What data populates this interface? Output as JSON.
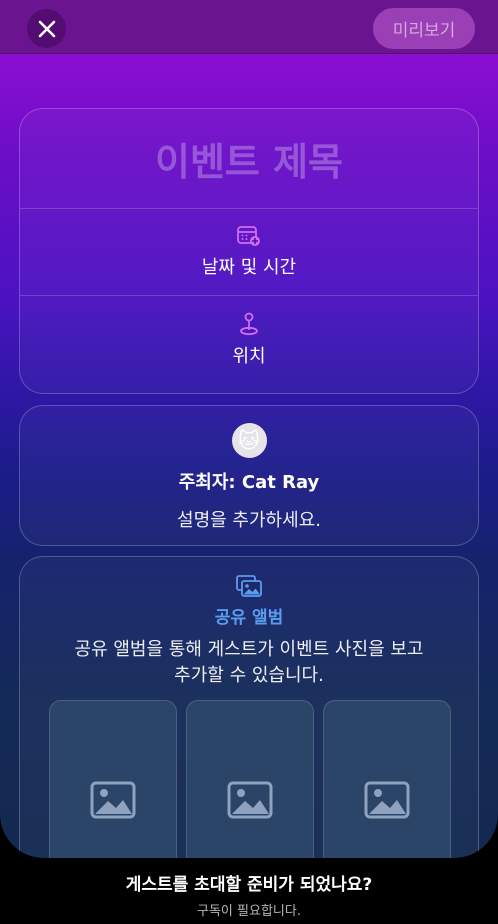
{
  "header": {
    "close_icon": "close-icon",
    "preview_label": "미리보기"
  },
  "event": {
    "title_placeholder": "이벤트 제목",
    "date_time_label": "날짜 및 시간",
    "date_icon": "calendar-add-icon",
    "location_label": "위치",
    "location_icon": "location-pin-icon"
  },
  "host": {
    "avatar_emoji": "🐱",
    "name_label": "주최자: Cat Ray",
    "description_placeholder": "설명을 추가하세요."
  },
  "album": {
    "icon": "photo-album-icon",
    "title": "공유 앨범",
    "description_line1": "공유 앨범을 통해 게스트가 이벤트 사진을 보고",
    "description_line2": "추가할 수 있습니다.",
    "tiles": [
      {
        "icon": "image-placeholder-icon"
      },
      {
        "icon": "image-placeholder-icon"
      },
      {
        "icon": "image-placeholder-icon"
      }
    ]
  },
  "footer": {
    "question": "게스트를 초대할 준비가 되었나요?",
    "subscription_note": "구독이 필요합니다."
  },
  "colors": {
    "accent_blue": "#5b9cf0",
    "header_purple": "#6a1490",
    "preview_button": "#9b3fb7"
  }
}
